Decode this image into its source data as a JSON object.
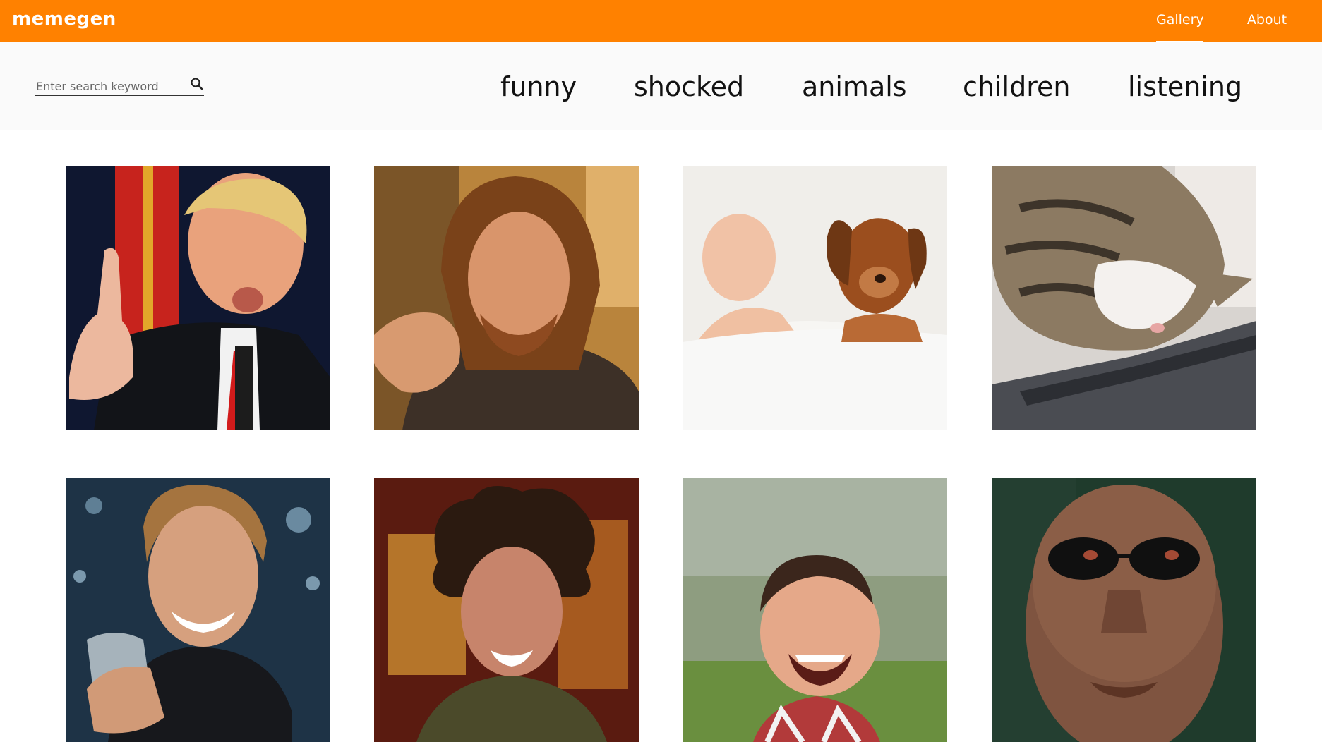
{
  "header": {
    "logo": "memegen",
    "nav": [
      {
        "label": "Gallery",
        "active": true
      },
      {
        "label": "About",
        "active": false
      }
    ],
    "background_color": "#ff8100"
  },
  "toolbar": {
    "search": {
      "placeholder": "Enter search keyword",
      "value": "",
      "icon": "search-icon"
    },
    "tags": [
      "funny",
      "shocked",
      "animals",
      "children",
      "listening"
    ]
  },
  "gallery": {
    "images": [
      {
        "name": "meme-image-1",
        "depicts": "man-with-raised-finger-at-podium"
      },
      {
        "name": "meme-image-2",
        "depicts": "long-haired-man-gesturing"
      },
      {
        "name": "meme-image-3",
        "depicts": "sleeping-baby-and-puppy"
      },
      {
        "name": "meme-image-4",
        "depicts": "cat-sleeping-on-laptop"
      },
      {
        "name": "meme-image-5",
        "depicts": "man-raising-glass"
      },
      {
        "name": "meme-image-6",
        "depicts": "man-with-wild-hair"
      },
      {
        "name": "meme-image-7",
        "depicts": "smiling-toddler"
      },
      {
        "name": "meme-image-8",
        "depicts": "bald-man-with-sunglasses"
      }
    ]
  }
}
